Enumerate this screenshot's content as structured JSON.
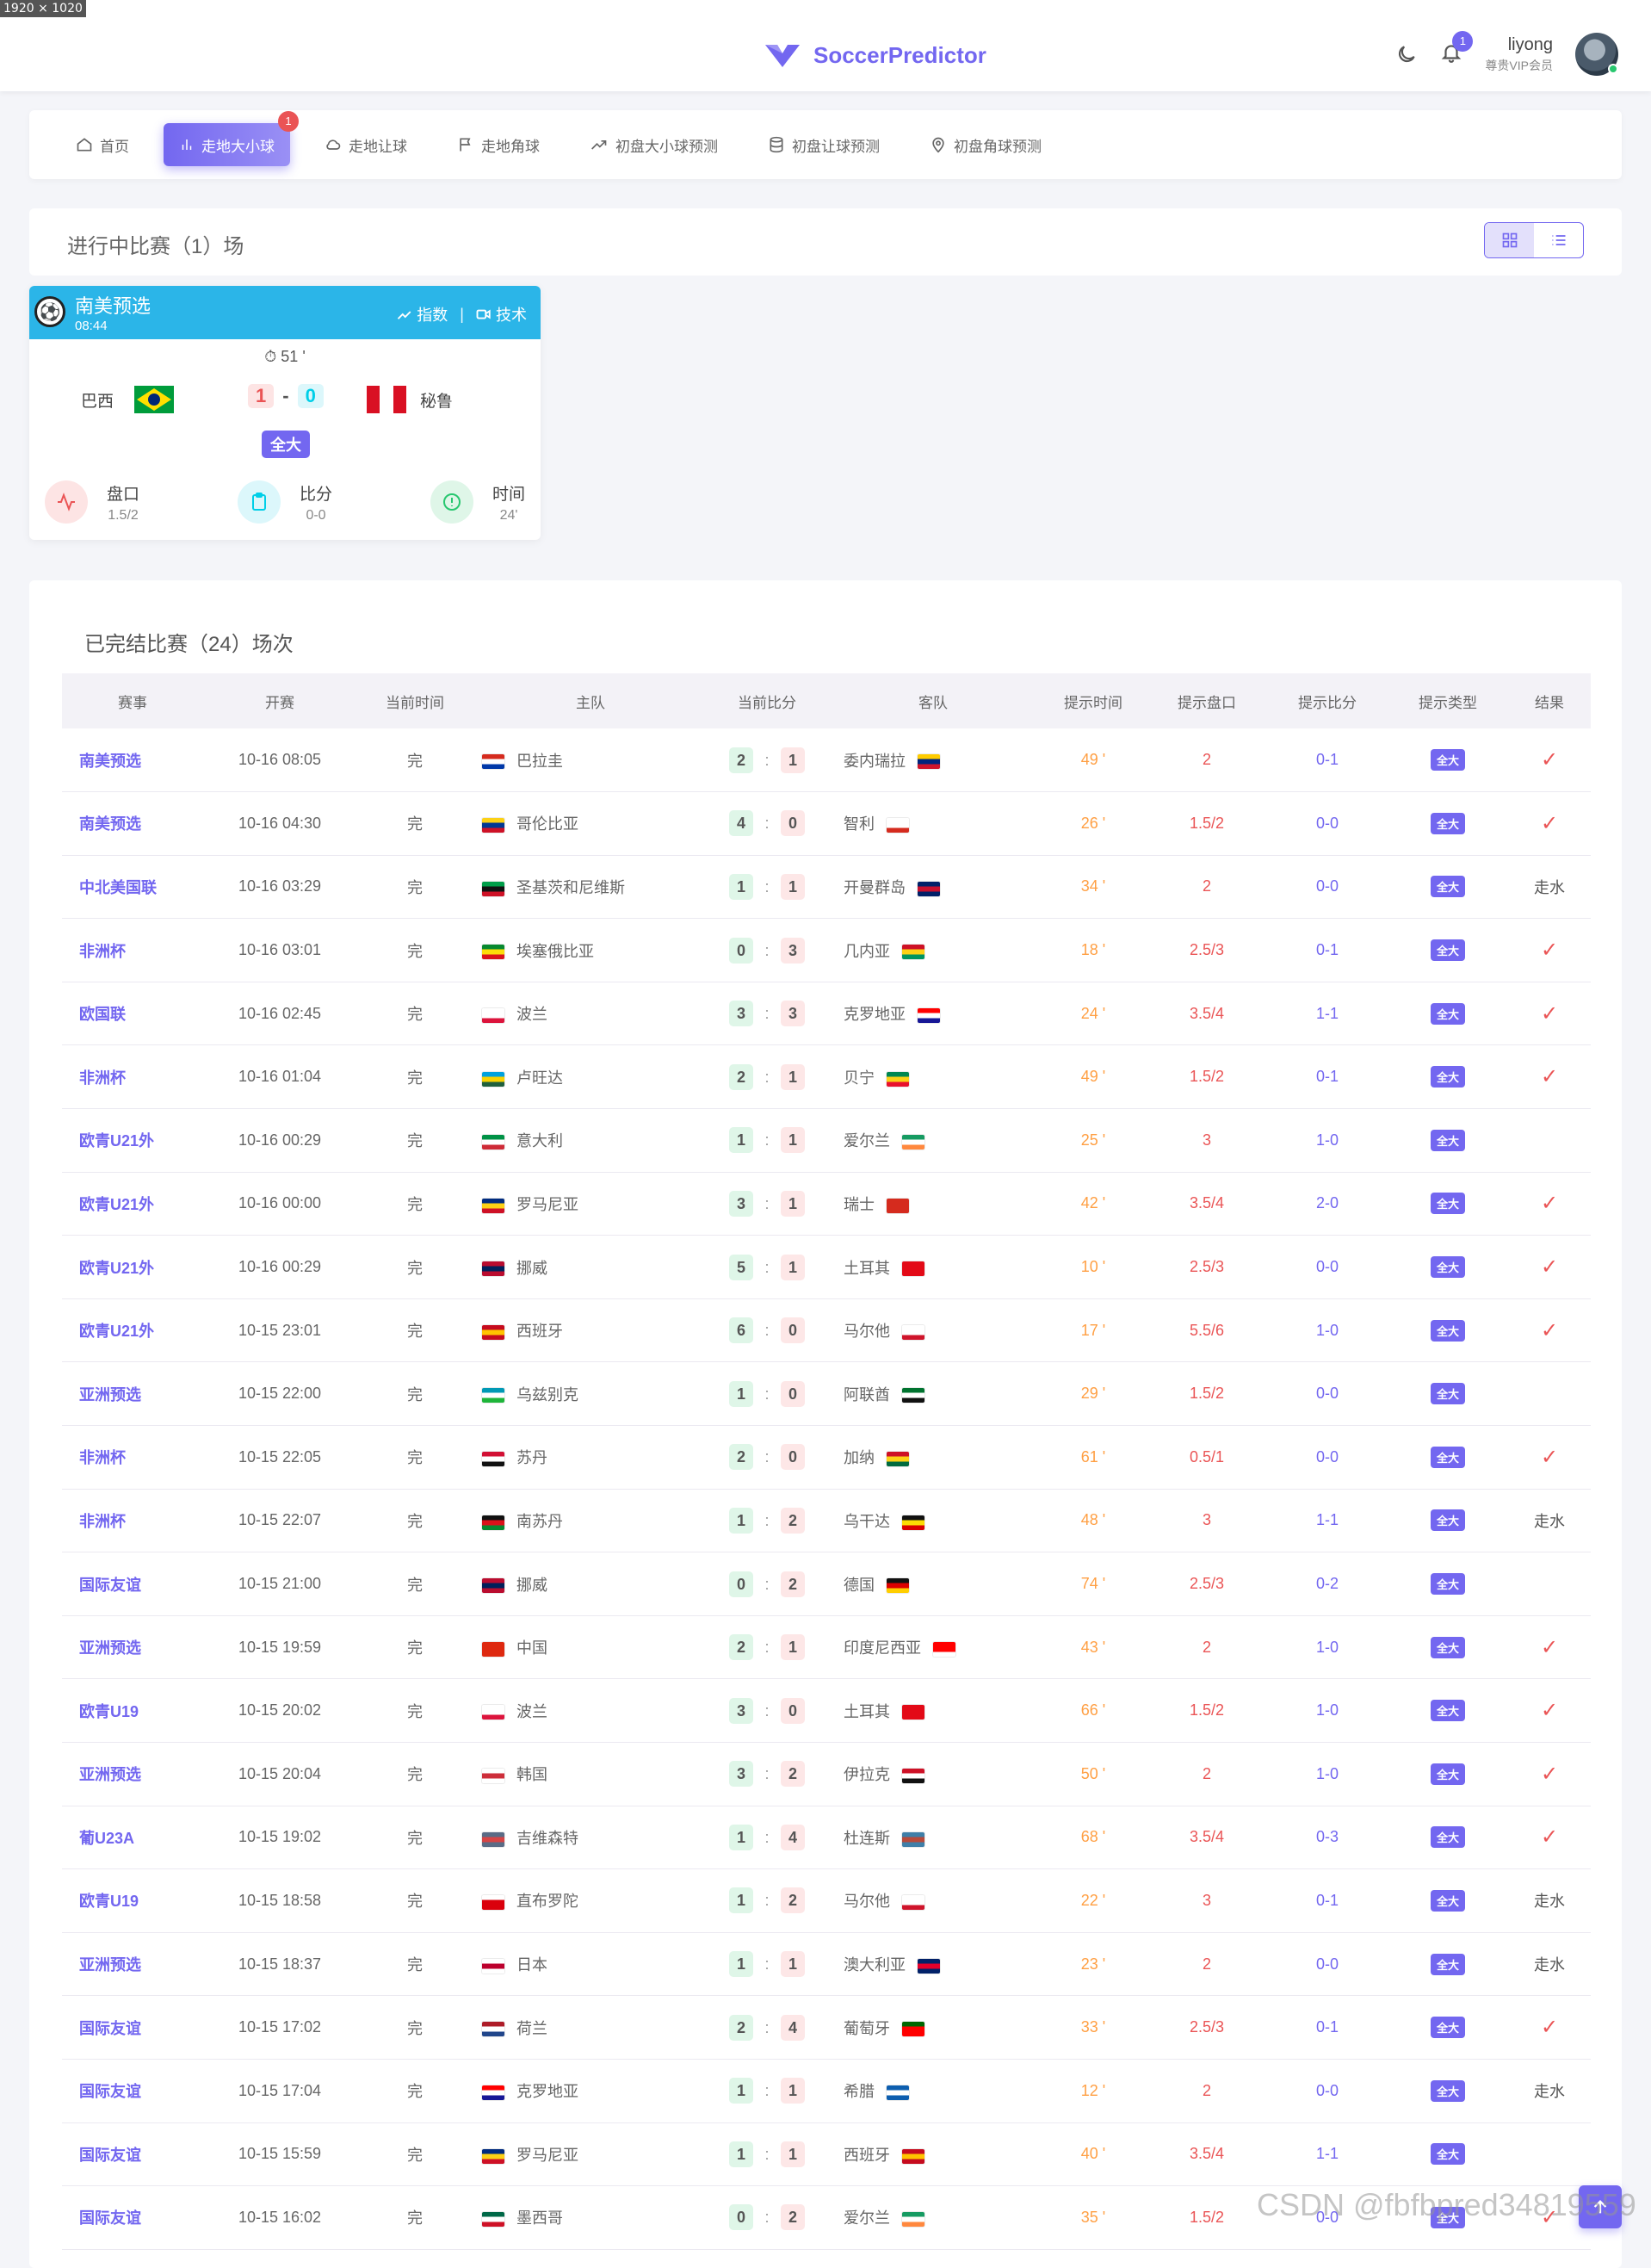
{
  "window": {
    "size_badge": "1920 × 1020"
  },
  "header": {
    "app_name": "SoccerPredictor",
    "notification_count": "1",
    "user": {
      "name": "liyong",
      "role": "尊贵VIP会员"
    }
  },
  "nav": {
    "items": [
      {
        "label": "首页",
        "icon": "home-icon"
      },
      {
        "label": "走地大小球",
        "icon": "bar-chart-icon",
        "badge": "1"
      },
      {
        "label": "走地让球",
        "icon": "cloud-icon"
      },
      {
        "label": "走地角球",
        "icon": "flag-icon"
      },
      {
        "label": "初盘大小球预测",
        "icon": "trending-up-icon"
      },
      {
        "label": "初盘让球预测",
        "icon": "database-icon"
      },
      {
        "label": "初盘角球预测",
        "icon": "map-pin-icon"
      }
    ]
  },
  "live": {
    "title": "进行中比赛（1）场",
    "match": {
      "league": "南美预选",
      "time": "08:44",
      "link_index": "指数",
      "link_tech": "技术",
      "minute": "51 '",
      "home": "巴西",
      "away": "秘鲁",
      "home_score": "1",
      "away_score": "0",
      "score_sep": "-",
      "tag": "全大",
      "stats": [
        {
          "label": "盘口",
          "value": "1.5/2",
          "color": "#ea5455"
        },
        {
          "label": "比分",
          "value": "0-0",
          "color": "#00cfe8"
        },
        {
          "label": "时间",
          "value": "24'",
          "color": "#28c76f"
        }
      ]
    }
  },
  "finished": {
    "title": "已完结比赛（24）场次",
    "columns": [
      "赛事",
      "开赛",
      "当前时间",
      "主队",
      "当前比分",
      "客队",
      "提示时间",
      "提示盘口",
      "提示比分",
      "提示类型",
      "结果"
    ],
    "rows": [
      {
        "league": "南美预选",
        "start": "10-16 08:05",
        "status": "完",
        "home": "巴拉圭",
        "hf": [
          "#d52b1e",
          "#ffffff",
          "#0038a8"
        ],
        "hs": "2",
        "as": "1",
        "away": "委内瑞拉",
        "af": [
          "#ffcc00",
          "#00247d",
          "#cf142b"
        ],
        "tip": "49 '",
        "pan": "2",
        "ps": "0-1",
        "type": "全大",
        "res": "✓"
      },
      {
        "league": "南美预选",
        "start": "10-16 04:30",
        "status": "完",
        "home": "哥伦比亚",
        "hf": [
          "#fcd116",
          "#003893",
          "#ce1126"
        ],
        "hs": "4",
        "as": "0",
        "away": "智利",
        "af": [
          "#ffffff",
          "#ffffff",
          "#d52b1e"
        ],
        "tip": "26 '",
        "pan": "1.5/2",
        "ps": "0-0",
        "type": "全大",
        "res": "✓"
      },
      {
        "league": "中北美国联",
        "start": "10-16 03:29",
        "status": "完",
        "home": "圣基茨和尼维斯",
        "hf": [
          "#009e49",
          "#111111",
          "#ce1126"
        ],
        "hs": "1",
        "as": "1",
        "away": "开曼群岛",
        "af": [
          "#012169",
          "#c8102e",
          "#012169"
        ],
        "tip": "34 '",
        "pan": "2",
        "ps": "0-0",
        "type": "全大",
        "res": "走水"
      },
      {
        "league": "非洲杯",
        "start": "10-16 03:01",
        "status": "完",
        "home": "埃塞俄比亚",
        "hf": [
          "#078930",
          "#fcdd09",
          "#da121a"
        ],
        "hs": "0",
        "as": "3",
        "away": "几内亚",
        "af": [
          "#ce1126",
          "#fcd116",
          "#009460"
        ],
        "tip": "18 '",
        "pan": "2.5/3",
        "ps": "0-1",
        "type": "全大",
        "res": "✓"
      },
      {
        "league": "欧国联",
        "start": "10-16 02:45",
        "status": "完",
        "home": "波兰",
        "hf": [
          "#ffffff",
          "#ffffff",
          "#dc143c"
        ],
        "hs": "3",
        "as": "3",
        "away": "克罗地亚",
        "af": [
          "#ff0000",
          "#ffffff",
          "#171796"
        ],
        "tip": "24 '",
        "pan": "3.5/4",
        "ps": "1-1",
        "type": "全大",
        "res": "✓"
      },
      {
        "league": "非洲杯",
        "start": "10-16 01:04",
        "status": "完",
        "home": "卢旺达",
        "hf": [
          "#00a1de",
          "#fad201",
          "#20603d"
        ],
        "hs": "2",
        "as": "1",
        "away": "贝宁",
        "af": [
          "#008751",
          "#fcd116",
          "#e8112d"
        ],
        "tip": "49 '",
        "pan": "1.5/2",
        "ps": "0-1",
        "type": "全大",
        "res": "✓"
      },
      {
        "league": "欧青U21外",
        "start": "10-16 00:29",
        "status": "完",
        "home": "意大利",
        "hf": [
          "#009246",
          "#ffffff",
          "#ce2b37"
        ],
        "hs": "1",
        "as": "1",
        "away": "爱尔兰",
        "af": [
          "#169b62",
          "#ffffff",
          "#ff883e"
        ],
        "tip": "25 '",
        "pan": "3",
        "ps": "1-0",
        "type": "全大",
        "res": ""
      },
      {
        "league": "欧青U21外",
        "start": "10-16 00:00",
        "status": "完",
        "home": "罗马尼亚",
        "hf": [
          "#002b7f",
          "#fcd116",
          "#ce1126"
        ],
        "hs": "3",
        "as": "1",
        "away": "瑞士",
        "af": [
          "#d52b1e",
          "#d52b1e",
          "#d52b1e"
        ],
        "tip": "42 '",
        "pan": "3.5/4",
        "ps": "2-0",
        "type": "全大",
        "res": "✓"
      },
      {
        "league": "欧青U21外",
        "start": "10-16 00:29",
        "status": "完",
        "home": "挪威",
        "hf": [
          "#ba0c2f",
          "#00205b",
          "#ba0c2f"
        ],
        "hs": "5",
        "as": "1",
        "away": "土耳其",
        "af": [
          "#e30a17",
          "#e30a17",
          "#e30a17"
        ],
        "tip": "10 '",
        "pan": "2.5/3",
        "ps": "0-0",
        "type": "全大",
        "res": "✓"
      },
      {
        "league": "欧青U21外",
        "start": "10-15 23:01",
        "status": "完",
        "home": "西班牙",
        "hf": [
          "#c60b1e",
          "#ffc400",
          "#c60b1e"
        ],
        "hs": "6",
        "as": "0",
        "away": "马尔他",
        "af": [
          "#ffffff",
          "#ffffff",
          "#cf142b"
        ],
        "tip": "17 '",
        "pan": "5.5/6",
        "ps": "1-0",
        "type": "全大",
        "res": "✓"
      },
      {
        "league": "亚洲预选",
        "start": "10-15 22:00",
        "status": "完",
        "home": "乌兹别克",
        "hf": [
          "#0099b5",
          "#ffffff",
          "#1eb53a"
        ],
        "hs": "1",
        "as": "0",
        "away": "阿联酋",
        "af": [
          "#00732f",
          "#ffffff",
          "#111111"
        ],
        "tip": "29 '",
        "pan": "1.5/2",
        "ps": "0-0",
        "type": "全大",
        "res": ""
      },
      {
        "league": "非洲杯",
        "start": "10-15 22:05",
        "status": "完",
        "home": "苏丹",
        "hf": [
          "#d21034",
          "#ffffff",
          "#111111"
        ],
        "hs": "2",
        "as": "0",
        "away": "加纳",
        "af": [
          "#ce1126",
          "#fcd116",
          "#006b3f"
        ],
        "tip": "61 '",
        "pan": "0.5/1",
        "ps": "0-0",
        "type": "全大",
        "res": "✓"
      },
      {
        "league": "非洲杯",
        "start": "10-15 22:07",
        "status": "完",
        "home": "南苏丹",
        "hf": [
          "#111111",
          "#da121a",
          "#078930"
        ],
        "hs": "1",
        "as": "2",
        "away": "乌干达",
        "af": [
          "#111111",
          "#fcdc04",
          "#d90000"
        ],
        "tip": "48 '",
        "pan": "3",
        "ps": "1-1",
        "type": "全大",
        "res": "走水"
      },
      {
        "league": "国际友谊",
        "start": "10-15 21:00",
        "status": "完",
        "home": "挪威",
        "hf": [
          "#ba0c2f",
          "#00205b",
          "#ba0c2f"
        ],
        "hs": "0",
        "as": "2",
        "away": "德国",
        "af": [
          "#111111",
          "#dd0000",
          "#ffce00"
        ],
        "tip": "74 '",
        "pan": "2.5/3",
        "ps": "0-2",
        "type": "全大",
        "res": ""
      },
      {
        "league": "亚洲预选",
        "start": "10-15 19:59",
        "status": "完",
        "home": "中国",
        "hf": [
          "#de2910",
          "#de2910",
          "#de2910"
        ],
        "hs": "2",
        "as": "1",
        "away": "印度尼西亚",
        "af": [
          "#ff0000",
          "#ff0000",
          "#ffffff"
        ],
        "tip": "43 '",
        "pan": "2",
        "ps": "1-0",
        "type": "全大",
        "res": "✓"
      },
      {
        "league": "欧青U19",
        "start": "10-15 20:02",
        "status": "完",
        "home": "波兰",
        "hf": [
          "#ffffff",
          "#ffffff",
          "#dc143c"
        ],
        "hs": "3",
        "as": "0",
        "away": "土耳其",
        "af": [
          "#e30a17",
          "#e30a17",
          "#e30a17"
        ],
        "tip": "66 '",
        "pan": "1.5/2",
        "ps": "1-0",
        "type": "全大",
        "res": "✓"
      },
      {
        "league": "亚洲预选",
        "start": "10-15 20:04",
        "status": "完",
        "home": "韩国",
        "hf": [
          "#ffffff",
          "#cd2e3a",
          "#ffffff"
        ],
        "hs": "3",
        "as": "2",
        "away": "伊拉克",
        "af": [
          "#ce1126",
          "#ffffff",
          "#111111"
        ],
        "tip": "50 '",
        "pan": "2",
        "ps": "1-0",
        "type": "全大",
        "res": "✓"
      },
      {
        "league": "葡U23A",
        "start": "10-15 19:02",
        "status": "完",
        "home": "吉维森特",
        "hf": [
          "#5a6c86",
          "#d64545",
          "#5a6c86"
        ],
        "hs": "1",
        "as": "4",
        "away": "杜连斯",
        "af": [
          "#3f7fa8",
          "#b84a3a",
          "#3f7fa8"
        ],
        "tip": "68 '",
        "pan": "3.5/4",
        "ps": "0-3",
        "type": "全大",
        "res": "✓"
      },
      {
        "league": "欧青U19",
        "start": "10-15 18:58",
        "status": "完",
        "home": "直布罗陀",
        "hf": [
          "#ffffff",
          "#da000c",
          "#da000c"
        ],
        "hs": "1",
        "as": "2",
        "away": "马尔他",
        "af": [
          "#ffffff",
          "#ffffff",
          "#cf142b"
        ],
        "tip": "22 '",
        "pan": "3",
        "ps": "0-1",
        "type": "全大",
        "res": "走水"
      },
      {
        "league": "亚洲预选",
        "start": "10-15 18:37",
        "status": "完",
        "home": "日本",
        "hf": [
          "#ffffff",
          "#bc002d",
          "#ffffff"
        ],
        "hs": "1",
        "as": "1",
        "away": "澳大利亚",
        "af": [
          "#012169",
          "#e4002b",
          "#012169"
        ],
        "tip": "23 '",
        "pan": "2",
        "ps": "0-0",
        "type": "全大",
        "res": "走水"
      },
      {
        "league": "国际友谊",
        "start": "10-15 17:02",
        "status": "完",
        "home": "荷兰",
        "hf": [
          "#ae1c28",
          "#ffffff",
          "#21468b"
        ],
        "hs": "2",
        "as": "4",
        "away": "葡萄牙",
        "af": [
          "#006600",
          "#ff0000",
          "#ff0000"
        ],
        "tip": "33 '",
        "pan": "2.5/3",
        "ps": "0-1",
        "type": "全大",
        "res": "✓"
      },
      {
        "league": "国际友谊",
        "start": "10-15 17:04",
        "status": "完",
        "home": "克罗地亚",
        "hf": [
          "#ff0000",
          "#ffffff",
          "#171796"
        ],
        "hs": "1",
        "as": "1",
        "away": "希腊",
        "af": [
          "#0d5eaf",
          "#ffffff",
          "#0d5eaf"
        ],
        "tip": "12 '",
        "pan": "2",
        "ps": "0-0",
        "type": "全大",
        "res": "走水"
      },
      {
        "league": "国际友谊",
        "start": "10-15 15:59",
        "status": "完",
        "home": "罗马尼亚",
        "hf": [
          "#002b7f",
          "#fcd116",
          "#ce1126"
        ],
        "hs": "1",
        "as": "1",
        "away": "西班牙",
        "af": [
          "#c60b1e",
          "#ffc400",
          "#c60b1e"
        ],
        "tip": "40 '",
        "pan": "3.5/4",
        "ps": "1-1",
        "type": "全大",
        "res": ""
      },
      {
        "league": "国际友谊",
        "start": "10-15 16:02",
        "status": "完",
        "home": "墨西哥",
        "hf": [
          "#006847",
          "#ffffff",
          "#ce1126"
        ],
        "hs": "0",
        "as": "2",
        "away": "爱尔兰",
        "af": [
          "#169b62",
          "#ffffff",
          "#ff883e"
        ],
        "tip": "35 '",
        "pan": "1.5/2",
        "ps": "0-0",
        "type": "全大",
        "res": "✓"
      }
    ]
  },
  "watermark": "CSDN @fbfbpred34819559",
  "colors": {
    "accent": "#7367f0",
    "live_header": "#2bb5e8",
    "danger": "#ea5455",
    "warning": "#ff9f43"
  }
}
